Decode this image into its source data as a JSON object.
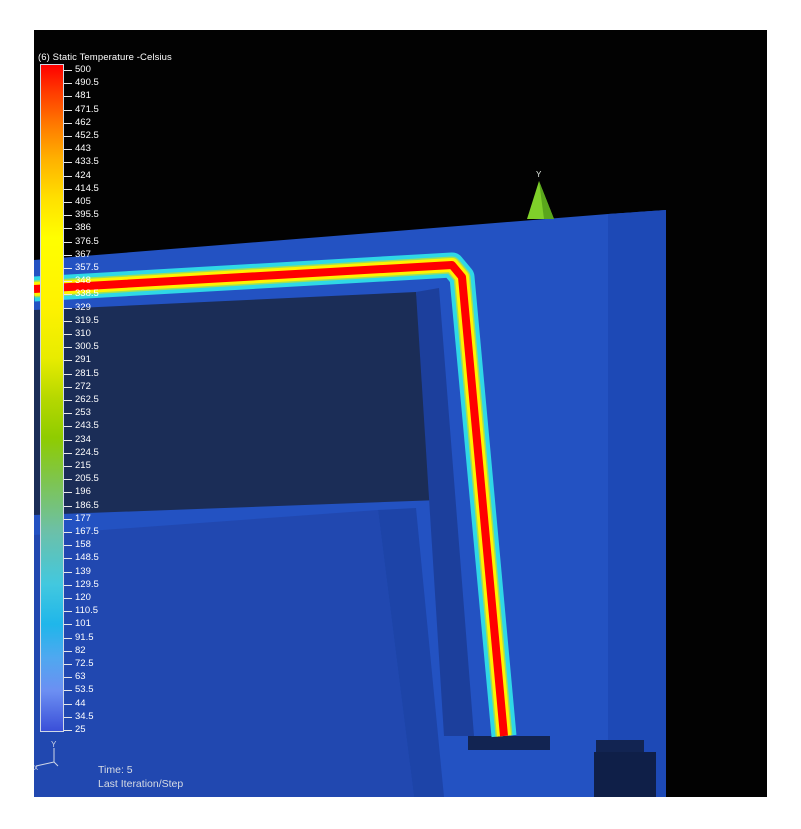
{
  "legend": {
    "title": "(6) Static Temperature -Celsius",
    "ticks": [
      "500",
      "490.5",
      "481",
      "471.5",
      "462",
      "452.5",
      "443",
      "433.5",
      "424",
      "414.5",
      "405",
      "395.5",
      "386",
      "376.5",
      "367",
      "357.5",
      "348",
      "338.5",
      "329",
      "319.5",
      "310",
      "300.5",
      "291",
      "281.5",
      "272",
      "262.5",
      "253",
      "243.5",
      "234",
      "224.5",
      "215",
      "205.5",
      "196",
      "186.5",
      "177",
      "167.5",
      "158",
      "148.5",
      "139",
      "129.5",
      "120",
      "110.5",
      "101",
      "91.5",
      "82",
      "72.5",
      "63",
      "53.5",
      "44",
      "34.5",
      "25"
    ]
  },
  "status": {
    "time": "Time: 5",
    "step": "Last Iteration/Step"
  },
  "axes": {
    "triad_y": "Y",
    "triad_x": "x",
    "view_axis_y": "Y"
  },
  "colors": {
    "background": "#020202",
    "model_blue": "#1f4bb4",
    "hot_red": "#ff0000",
    "warm_yellow": "#fff200",
    "cool_cyan": "#2fd8e6"
  }
}
